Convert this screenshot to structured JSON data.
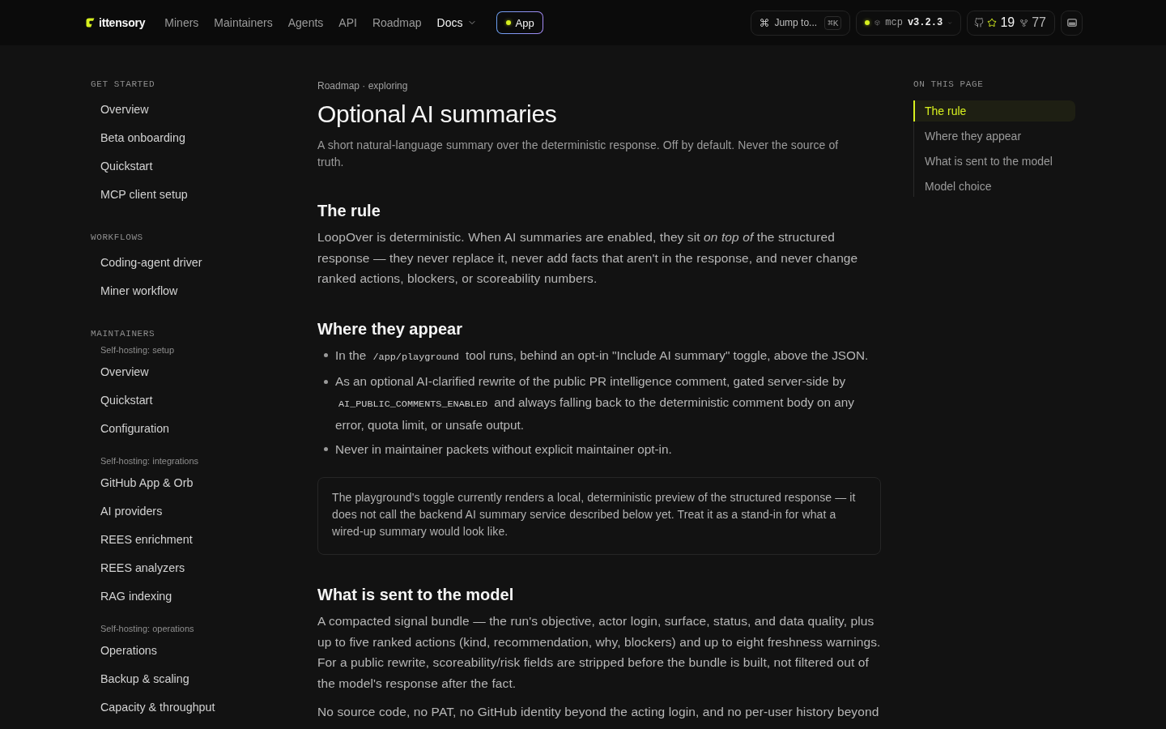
{
  "header": {
    "logo": {
      "text": "ittensory"
    },
    "nav": [
      {
        "label": "Miners",
        "kind": "link",
        "selected": false
      },
      {
        "label": "Maintainers",
        "kind": "link",
        "selected": false
      },
      {
        "label": "Agents",
        "kind": "link",
        "selected": false
      },
      {
        "label": "API",
        "kind": "link",
        "selected": false
      },
      {
        "label": "Roadmap",
        "kind": "link",
        "selected": false
      },
      {
        "label": "Docs",
        "kind": "dropdown",
        "selected": true
      }
    ],
    "app_button": {
      "label": "App"
    },
    "search": {
      "label": "Jump to...",
      "shortcut": "⌘K"
    },
    "version": {
      "name": "mcp",
      "version": "v3.2.3"
    },
    "github": {
      "stars": "19",
      "forks": "77"
    }
  },
  "sidebar": {
    "sections": [
      {
        "title": "GET STARTED",
        "groups": [
          {
            "items": [
              {
                "label": "Overview",
                "selected": false
              },
              {
                "label": "Beta onboarding",
                "selected": false
              },
              {
                "label": "Quickstart",
                "selected": false
              },
              {
                "label": "MCP client setup",
                "selected": false
              }
            ]
          }
        ]
      },
      {
        "title": "WORKFLOWS",
        "groups": [
          {
            "items": [
              {
                "label": "Coding-agent driver",
                "selected": false
              },
              {
                "label": "Miner workflow",
                "selected": false
              }
            ]
          }
        ]
      },
      {
        "title": "MAINTAINERS",
        "groups": [
          {
            "label": "Self-hosting: setup",
            "items": [
              {
                "label": "Overview",
                "selected": false
              },
              {
                "label": "Quickstart",
                "selected": false
              },
              {
                "label": "Configuration",
                "selected": false
              }
            ]
          },
          {
            "label": "Self-hosting: integrations",
            "items": [
              {
                "label": "GitHub App & Orb",
                "selected": false
              },
              {
                "label": "AI providers",
                "selected": false
              },
              {
                "label": "REES enrichment",
                "selected": false
              },
              {
                "label": "REES analyzers",
                "selected": false
              },
              {
                "label": "RAG indexing",
                "selected": false
              }
            ]
          },
          {
            "label": "Self-hosting: operations",
            "items": [
              {
                "label": "Operations",
                "selected": false
              },
              {
                "label": "Backup & scaling",
                "selected": false
              },
              {
                "label": "Capacity & throughput",
                "selected": false
              }
            ]
          }
        ]
      }
    ]
  },
  "article": {
    "breadcrumb": "Roadmap · exploring",
    "title": "Optional AI summaries",
    "lead": "A short natural-language summary over the deterministic response. Off by default. Never the source of truth.",
    "sections": [
      {
        "heading": "The rule",
        "blocks": [
          {
            "kind": "paragraph",
            "text": "LoopOver is deterministic. When AI summaries are enabled, they sit *on top of* the structured response — they never replace it, never add facts that aren't in the response, and never change ranked actions, blockers, or scoreability numbers."
          }
        ]
      },
      {
        "heading": "Where they appear",
        "blocks": [
          {
            "kind": "list",
            "items": [
              {
                "parts": [
                  {
                    "kind": "text",
                    "text": "In the"
                  },
                  {
                    "kind": "code",
                    "text": "/app/playground"
                  },
                  {
                    "kind": "text",
                    "text": "tool runs, behind an opt-in \"Include AI summary\" toggle, above the JSON."
                  }
                ]
              },
              {
                "parts": [
                  {
                    "kind": "text",
                    "text": "As an optional AI-clarified rewrite of the public PR intelligence comment, gated server-side by"
                  },
                  {
                    "kind": "code",
                    "text": "AI_PUBLIC_COMMENTS_ENABLED"
                  },
                  {
                    "kind": "text",
                    "text": "and always falling back to the deterministic comment body on any error, quota limit, or unsafe output."
                  }
                ]
              },
              {
                "parts": [
                  {
                    "kind": "text",
                    "text": "Never in maintainer packets without explicit maintainer opt-in."
                  }
                ]
              }
            ]
          },
          {
            "kind": "note",
            "text": "The playground's toggle currently renders a local, deterministic preview of the structured response — it does not call the backend AI summary service described below yet. Treat it as a stand-in for what a wired-up summary would look like."
          }
        ]
      },
      {
        "heading": "What is sent to the model",
        "blocks": [
          {
            "kind": "paragraph",
            "text": "A compacted signal bundle — the run's objective, actor login, surface, status, and data quality, plus up to five ranked actions (kind, recommendation, why, blockers) and up to eight freshness warnings. For a public rewrite, scoreability/risk fields are stripped before the bundle is built, not filtered out of the model's response after the fact."
          },
          {
            "kind": "paragraph",
            "text": "No source code, no PAT, no GitHub identity beyond the acting login, and no per-user history beyond"
          }
        ]
      }
    ]
  },
  "toc": {
    "title": "ON THIS PAGE",
    "items": [
      {
        "label": "The rule",
        "selected": true
      },
      {
        "label": "Where they appear",
        "selected": false
      },
      {
        "label": "What is sent to the model",
        "selected": false
      },
      {
        "label": "Model choice",
        "selected": false
      }
    ]
  }
}
